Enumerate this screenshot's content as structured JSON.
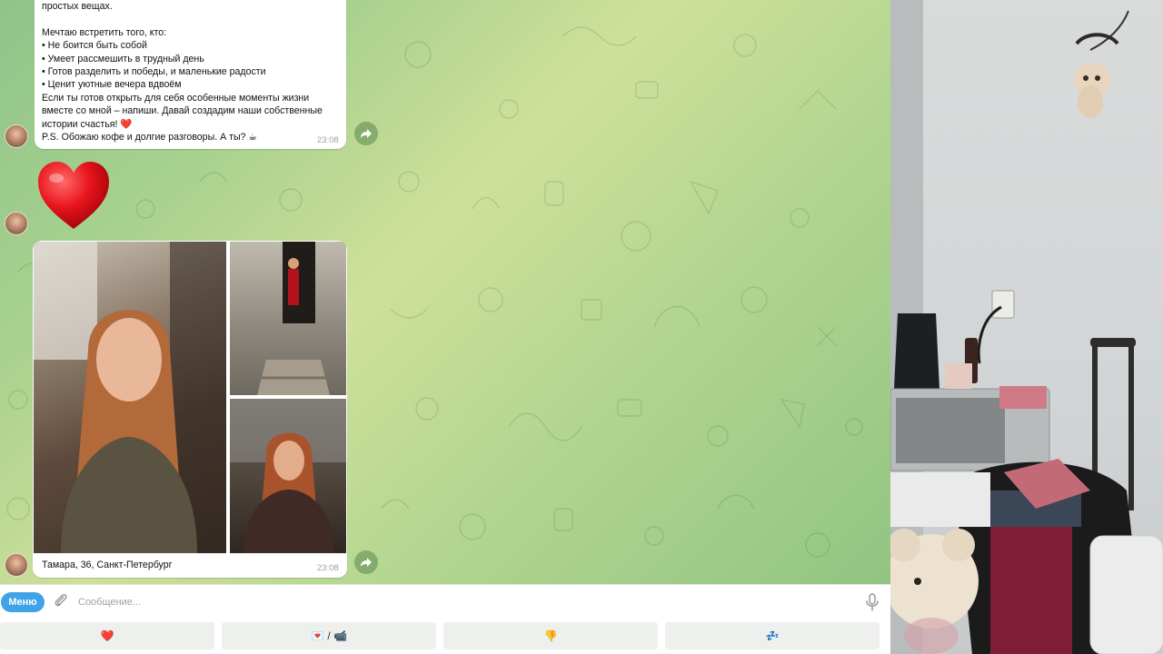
{
  "chat": {
    "message_text": {
      "lines": [
        "простых вещах.",
        "",
        "Мечтаю встретить того, кто:",
        "• Не боится быть собой",
        "• Умеет рассмешить в трудный день",
        "• Готов разделить и победы, и маленькие радости",
        "• Ценит уютные вечера вдвоём",
        "Если ты готов открыть для себя особенные моменты жизни",
        "вместе со мной – напиши. Давай создадим наши собственные",
        "истории счастья! ❤️",
        "P.S. Обожаю кофе и долгие разговоры. А ты? ☕"
      ],
      "time": "23:08"
    },
    "sticker": {
      "icon": "red-heart-sticker"
    },
    "photo_message": {
      "caption": "Тамара, 36, Санкт-Петербург",
      "time": "23:08"
    }
  },
  "composer": {
    "menu_label": "Меню",
    "placeholder": "Сообщение..."
  },
  "keyboard": {
    "buttons": [
      {
        "label": "❤️"
      },
      {
        "label": "💌 / 📹"
      },
      {
        "label": "👎"
      },
      {
        "label": "💤"
      }
    ]
  },
  "colors": {
    "menu_button": "#3ea4e7",
    "chat_background": "#a9d28e",
    "bubble": "#ffffff"
  }
}
